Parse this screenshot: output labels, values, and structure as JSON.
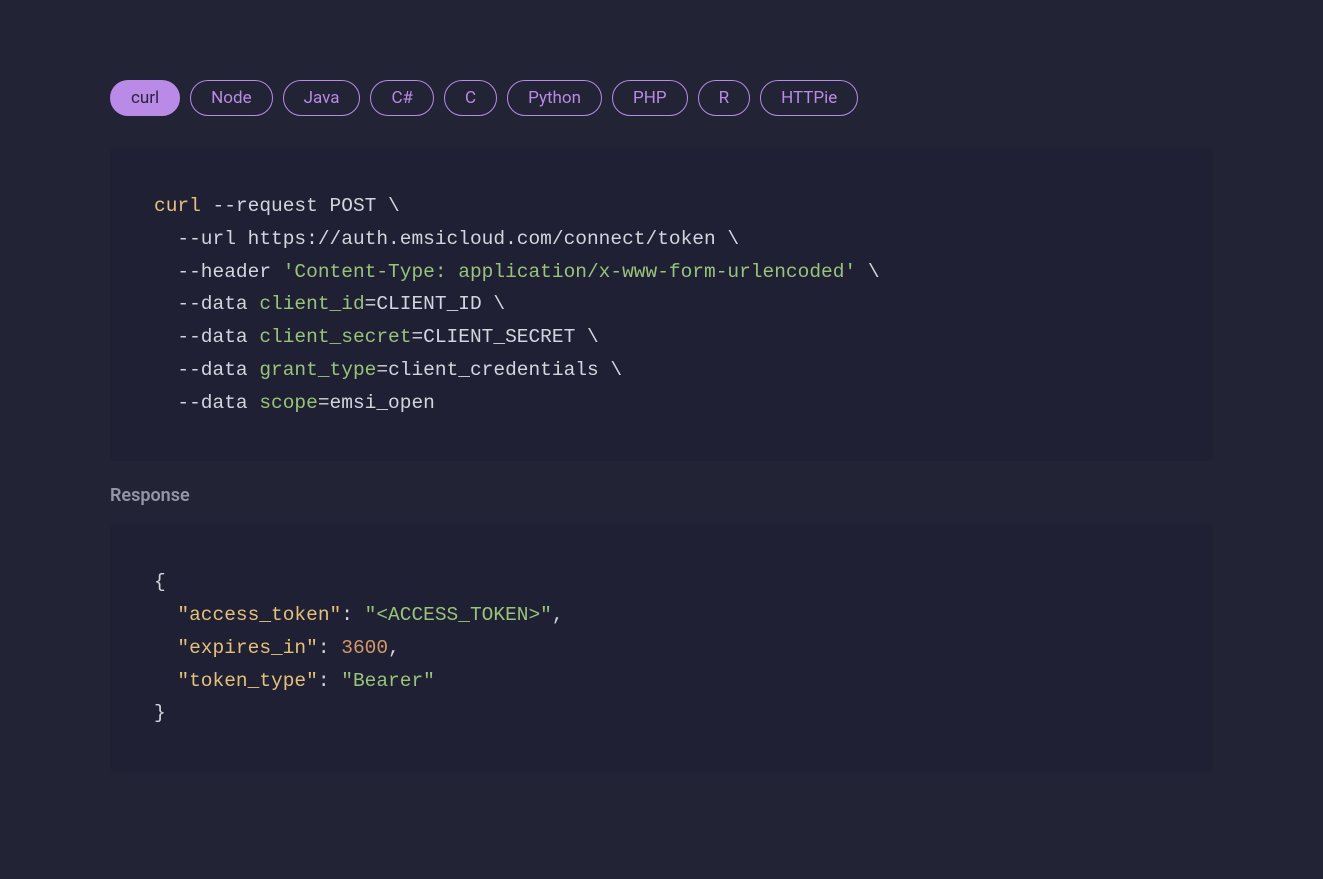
{
  "tabs": [
    {
      "label": "curl",
      "active": true
    },
    {
      "label": "Node",
      "active": false
    },
    {
      "label": "Java",
      "active": false
    },
    {
      "label": "C#",
      "active": false
    },
    {
      "label": "C",
      "active": false
    },
    {
      "label": "Python",
      "active": false
    },
    {
      "label": "PHP",
      "active": false
    },
    {
      "label": "R",
      "active": false
    },
    {
      "label": "HTTPie",
      "active": false
    }
  ],
  "request_code": {
    "cmd": "curl",
    "lines": [
      {
        "flag": " --request",
        "rest": " POST \\"
      },
      {
        "flag": "  --url",
        "rest": " https://auth.emsicloud.com/connect/token \\"
      },
      {
        "flag": "  --header",
        "str": " 'Content-Type: application/x-www-form-urlencoded'",
        "rest": " \\"
      },
      {
        "flag": "  --data",
        "var": " client_id",
        "eq": "=",
        "val": "CLIENT_ID",
        "rest": " \\"
      },
      {
        "flag": "  --data",
        "var": " client_secret",
        "eq": "=",
        "val": "CLIENT_SECRET",
        "rest": " \\"
      },
      {
        "flag": "  --data",
        "var": " grant_type",
        "eq": "=",
        "val": "client_credentials",
        "rest": " \\"
      },
      {
        "flag": "  --data",
        "var": " scope",
        "eq": "=",
        "val": "emsi_open",
        "rest": ""
      }
    ]
  },
  "response_label": "Response",
  "response_json": {
    "open": "{",
    "rows": [
      {
        "key": "\"access_token\"",
        "colon": ": ",
        "value": "\"<ACCESS_TOKEN>\"",
        "value_class": "tok-str",
        "comma": ","
      },
      {
        "key": "\"expires_in\"",
        "colon": ": ",
        "value": "3600",
        "value_class": "tok-num",
        "comma": ","
      },
      {
        "key": "\"token_type\"",
        "colon": ": ",
        "value": "\"Bearer\"",
        "value_class": "tok-str",
        "comma": ""
      }
    ],
    "close": "}"
  }
}
